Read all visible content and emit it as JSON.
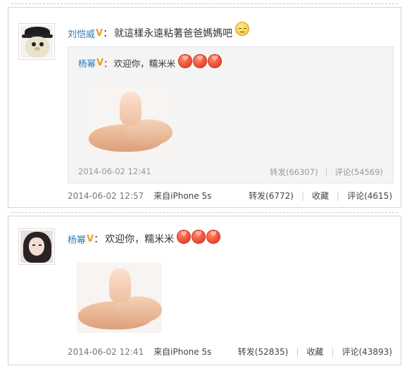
{
  "post1": {
    "author": "刘恺威",
    "text": "就這樣永遠粘著爸爸媽媽吧",
    "emoji": "sad-face-icon",
    "repost": {
      "author": "杨幂",
      "text": "欢迎你，糯米米",
      "emoji": "heart-icon",
      "time": "2014-06-02 12:41",
      "forward": "转发(66307)",
      "comment": "评论(54569)"
    },
    "time": "2014-06-02 12:57",
    "source": "来自iPhone 5s",
    "forward": "转发(6772)",
    "favorite": "收藏",
    "comment": "评论(4615)"
  },
  "post2": {
    "author": "杨幂",
    "text": "欢迎你，糯米米",
    "emoji": "heart-icon",
    "time": "2014-06-02 12:41",
    "source": "来自iPhone 5s",
    "forward": "转发(52835)",
    "favorite": "收藏",
    "comment": "评论(43893)"
  },
  "verified_badge": "V",
  "colon": "："
}
